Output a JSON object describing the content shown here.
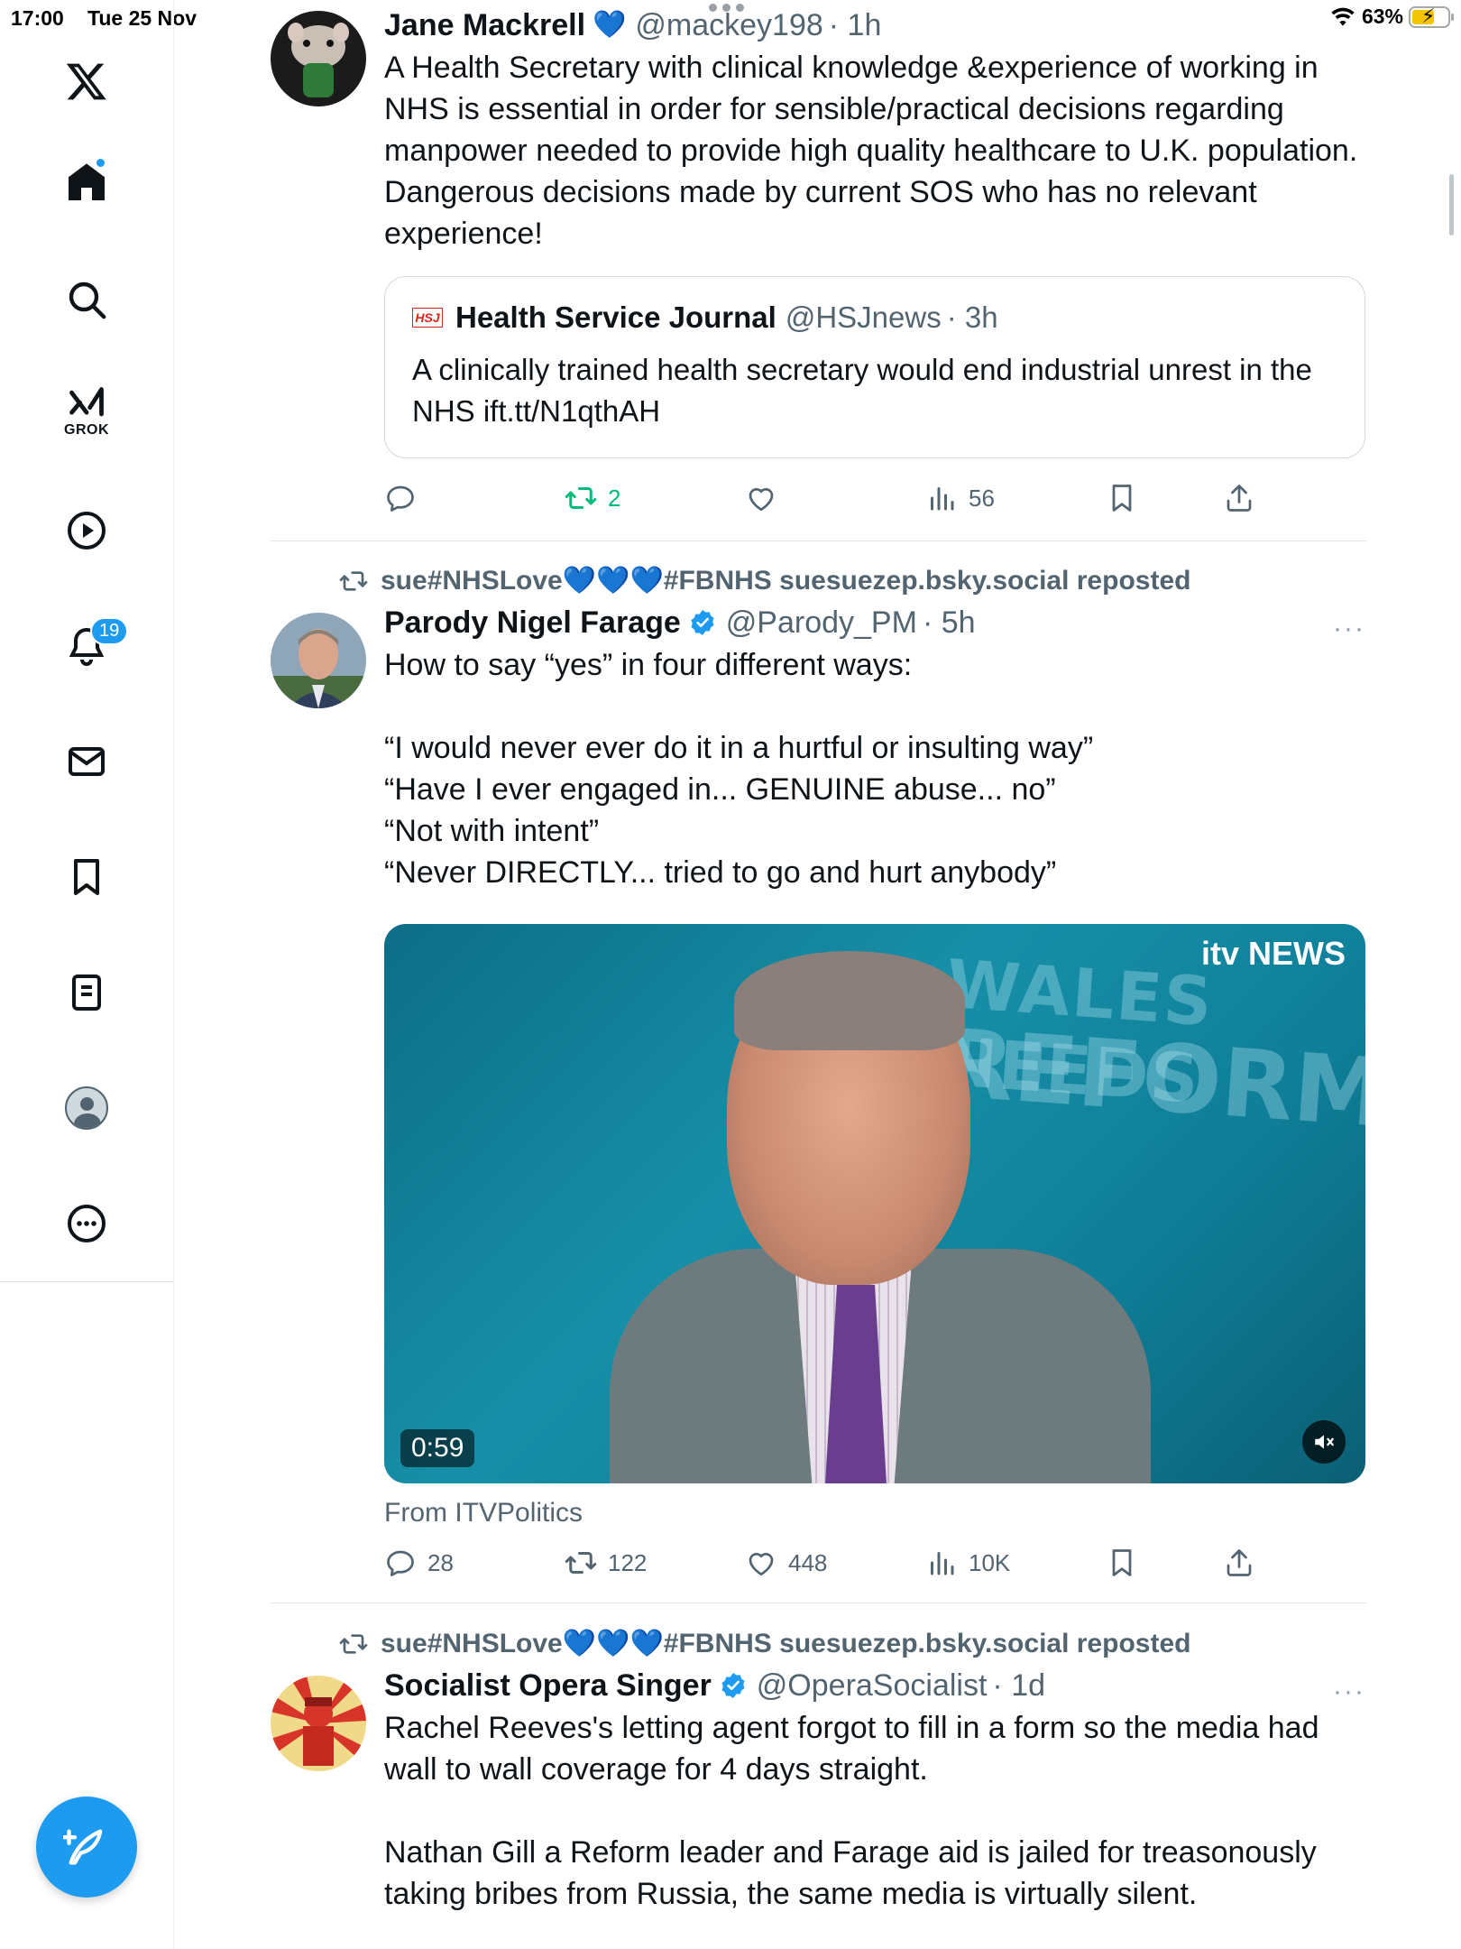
{
  "status_bar": {
    "time": "17:00",
    "date": "Tue 25 Nov",
    "battery": "63%",
    "battery_level": 0.63
  },
  "sidebar": {
    "grok_label": "GROK",
    "notifications_count": "19"
  },
  "posts": [
    {
      "name": "Jane Mackrell",
      "name_emoji": "💙",
      "handle": "@mackey198",
      "time": "· 1h",
      "text": "A Health Secretary with clinical knowledge &experience of working in NHS is essential in order for sensible/practical decisions regarding manpower needed to provide high quality healthcare to U.K. population. Dangerous decisions made by current SOS who has no relevant experience!",
      "quote": {
        "name": "Health Service Journal",
        "logo_text": "HSJ",
        "handle": "@HSJnews",
        "time": "· 3h",
        "text": "A clinically trained health secretary would end industrial unrest in the NHS ift.tt/N1qthAH"
      },
      "actions": {
        "replies": "",
        "reposts": "2",
        "likes": "",
        "views": "56"
      }
    },
    {
      "reposted_by": "sue#NHSLove💙💙💙#FBNHS suesuezep.bsky.social reposted",
      "name": "Parody Nigel Farage",
      "handle": "@Parody_PM",
      "time": "· 5h",
      "more": "···",
      "text": "How to say “yes” in four different ways:\n\n“I would never ever do it in a hurtful or insulting way”\n“Have I ever engaged in... GENUINE abuse... no”\n“Not with intent”\n“Never DIRECTLY... tried to go and hurt anybody”",
      "media": {
        "bg_line1": "WALES NEEDS",
        "bg_line2": "REFORM",
        "brand": "itv NEWS",
        "duration": "0:59"
      },
      "source": "From ITVPolitics",
      "actions": {
        "replies": "28",
        "reposts": "122",
        "likes": "448",
        "views": "10K"
      }
    },
    {
      "reposted_by": "sue#NHSLove💙💙💙#FBNHS suesuezep.bsky.social reposted",
      "name": "Socialist Opera Singer",
      "handle": "@OperaSocialist",
      "time": "· 1d",
      "more": "···",
      "text": "Rachel Reeves's letting agent forgot to fill in a form so the media had wall to wall coverage for 4 days straight.\n\nNathan Gill a Reform leader and Farage aid is jailed for treasonously taking bribes from Russia, the same media is virtually silent."
    }
  ],
  "colors": {
    "accent": "#1d9bf0",
    "retweet_green": "#00ba7c",
    "muted_text": "#536471",
    "divider": "#e1e6e8"
  },
  "icons": [
    "x-logo-icon",
    "home-icon",
    "search-icon",
    "grok-icon",
    "video-icon",
    "bell-icon",
    "mail-icon",
    "bookmark-icon",
    "list-icon",
    "profile-icon",
    "more-icon",
    "compose-icon",
    "reply-icon",
    "retweet-icon",
    "heart-icon",
    "views-icon",
    "share-icon",
    "verified-icon",
    "mute-icon"
  ]
}
